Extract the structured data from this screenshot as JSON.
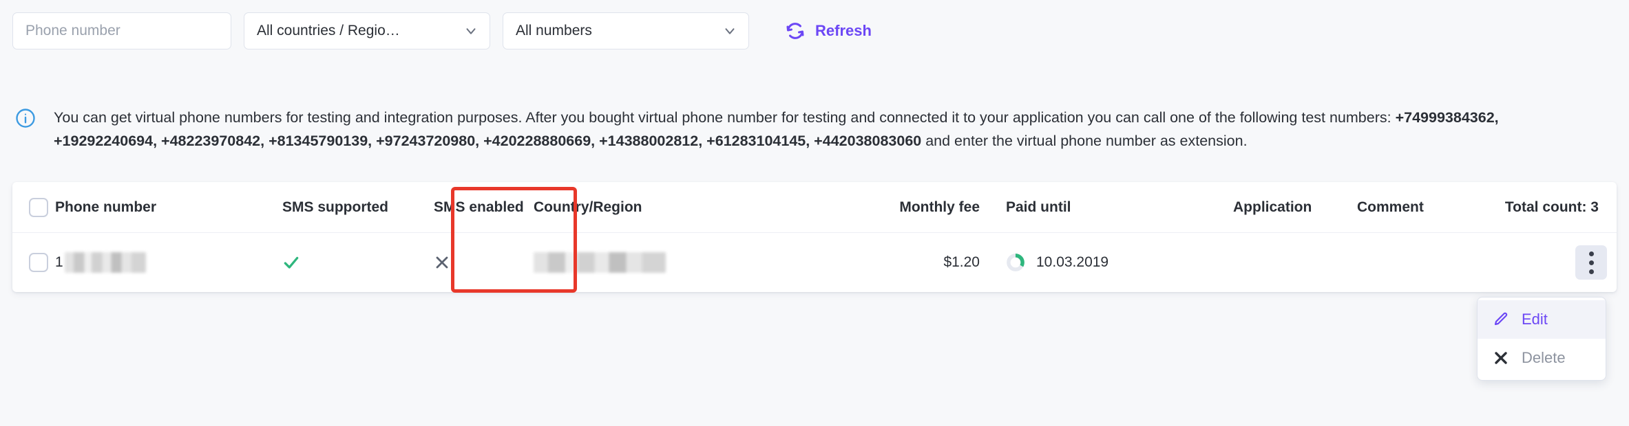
{
  "filters": {
    "phone_input": {
      "value": "",
      "placeholder": "Phone number"
    },
    "country_select": {
      "value": "All countries / Regio…"
    },
    "numbers_select": {
      "value": "All numbers"
    },
    "refresh_label": "Refresh"
  },
  "info": {
    "line1": "You can get virtual phone numbers for testing and integration purposes. After you bought virtual phone number for testing and connected it to your application you can call one of the following test numbers:",
    "test_numbers": "+74999384362, +19292240694, +48223970842, +81345790139, +97243720980, +420228880669, +14388002812, +61283104145, +442038083060",
    "line2_tail": " and enter the virtual phone number as extension."
  },
  "table": {
    "headers": {
      "phone_number": "Phone number",
      "sms_supported": "SMS supported",
      "sms_enabled": "SMS enabled",
      "country_region": "Country/Region",
      "monthly_fee": "Monthly fee",
      "paid_until": "Paid until",
      "application": "Application",
      "comment": "Comment",
      "total_count": "Total count: 3"
    },
    "rows": [
      {
        "phone_number_prefix": "1",
        "phone_number_redacted": true,
        "sms_supported": "check",
        "sms_enabled": "cross",
        "country_region_redacted": true,
        "monthly_fee": "$1.20",
        "paid_until": "10.03.2019",
        "application": "",
        "comment": ""
      }
    ]
  },
  "context_menu": {
    "items": [
      {
        "label": "Edit",
        "icon": "pencil-icon",
        "state": "highlighted"
      },
      {
        "label": "Delete",
        "icon": "close-icon",
        "state": "normal"
      }
    ]
  },
  "colors": {
    "accent_purple": "#6c47f5",
    "info_blue": "#3b9ae1",
    "success_green": "#2eb67d",
    "annotation_red": "#e8382a",
    "page_bg": "#f7f8fa"
  }
}
